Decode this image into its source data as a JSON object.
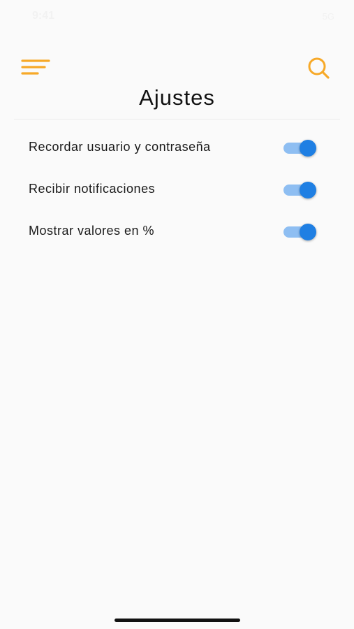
{
  "status_bar": {
    "time": "9:41",
    "indicators": "5G"
  },
  "header": {
    "menu_icon": "hamburger-menu-icon",
    "search_icon": "search-icon",
    "title": "Ajustes"
  },
  "settings": [
    {
      "label": "Recordar usuario y contraseña",
      "enabled": true
    },
    {
      "label": "Recibir notificaciones",
      "enabled": true
    },
    {
      "label": "Mostrar valores en %",
      "enabled": true
    }
  ],
  "colors": {
    "accent": "#f7a928",
    "toggle_on_thumb": "#1f7fe3",
    "toggle_on_track": "#8ebef2",
    "background": "#fafafa"
  }
}
